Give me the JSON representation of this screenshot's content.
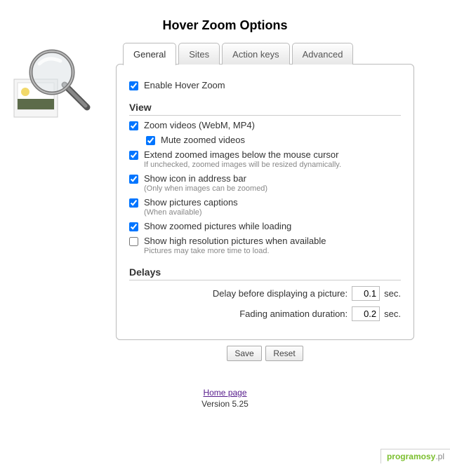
{
  "title": "Hover Zoom Options",
  "tabs": [
    {
      "label": "General",
      "active": true
    },
    {
      "label": "Sites",
      "active": false
    },
    {
      "label": "Action keys",
      "active": false
    },
    {
      "label": "Advanced",
      "active": false
    }
  ],
  "enable": {
    "label": "Enable Hover Zoom",
    "checked": true
  },
  "sections": {
    "view": {
      "heading": "View",
      "options": [
        {
          "id": "zoom-videos",
          "label": "Zoom videos (WebM, MP4)",
          "checked": true,
          "hint": "",
          "indent": false
        },
        {
          "id": "mute-videos",
          "label": "Mute zoomed videos",
          "checked": true,
          "hint": "",
          "indent": true
        },
        {
          "id": "extend-below",
          "label": "Extend zoomed images below the mouse cursor",
          "checked": true,
          "hint": "If unchecked, zoomed images will be resized dynamically.",
          "indent": false
        },
        {
          "id": "show-icon",
          "label": "Show icon in address bar",
          "checked": true,
          "hint": "(Only when images can be zoomed)",
          "indent": false
        },
        {
          "id": "captions",
          "label": "Show pictures captions",
          "checked": true,
          "hint": "(When available)",
          "indent": false
        },
        {
          "id": "while-loading",
          "label": "Show zoomed pictures while loading",
          "checked": true,
          "hint": "",
          "indent": false
        },
        {
          "id": "hires",
          "label": "Show high resolution pictures when available",
          "checked": false,
          "hint": "Pictures may take more time to load.",
          "indent": false
        }
      ]
    },
    "delays": {
      "heading": "Delays",
      "rows": [
        {
          "id": "display-delay",
          "label": "Delay before displaying a picture:",
          "value": "0.1",
          "unit": "sec."
        },
        {
          "id": "fade-duration",
          "label": "Fading animation duration:",
          "value": "0.2",
          "unit": "sec."
        }
      ]
    }
  },
  "buttons": {
    "save": "Save",
    "reset": "Reset"
  },
  "footer": {
    "home": "Home page",
    "version": "Version 5.25"
  },
  "watermark": {
    "brand": "programosy",
    "tld": ".pl"
  }
}
